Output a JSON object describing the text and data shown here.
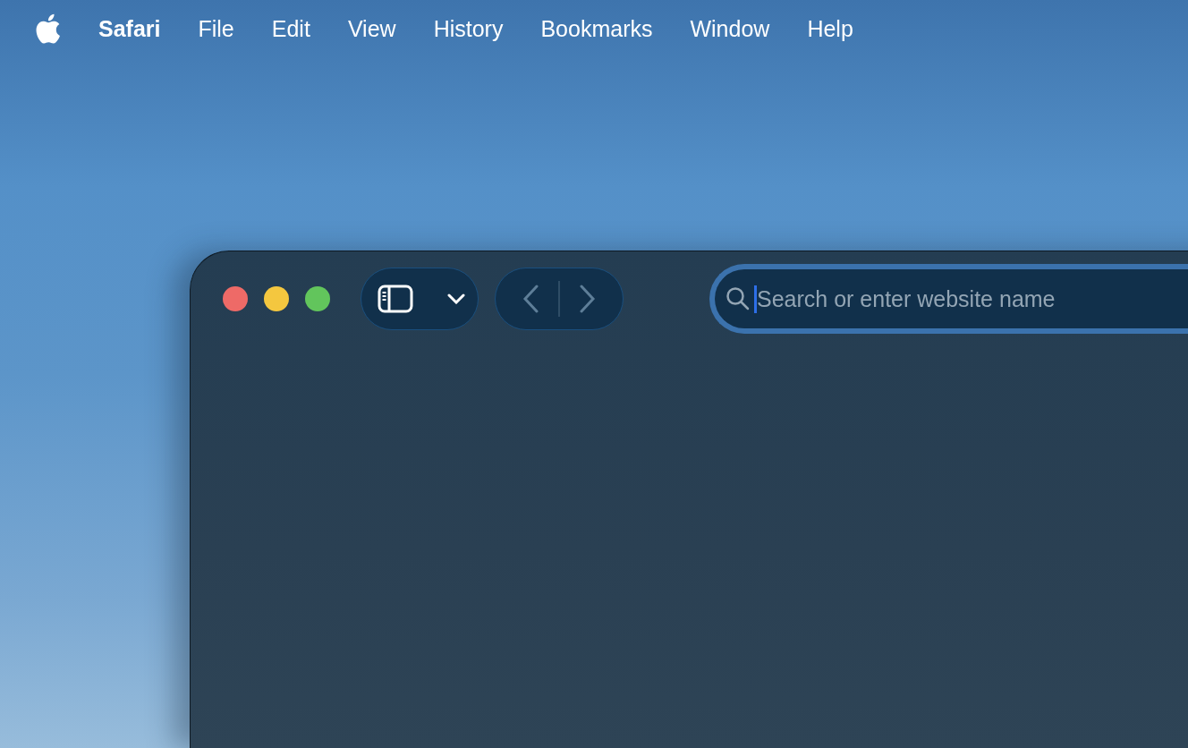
{
  "menu_bar": {
    "app_name": "Safari",
    "items": [
      "File",
      "Edit",
      "View",
      "History",
      "Bookmarks",
      "Window",
      "Help"
    ]
  },
  "window": {
    "traffic_lights": [
      {
        "color": "#ee6a67"
      },
      {
        "color": "#f4c73f"
      },
      {
        "color": "#62c55c"
      }
    ],
    "back_button": {
      "disabled": true
    },
    "forward_button": {
      "disabled": true
    },
    "address_bar": {
      "placeholder": "Search or enter website name",
      "focused": true
    }
  }
}
